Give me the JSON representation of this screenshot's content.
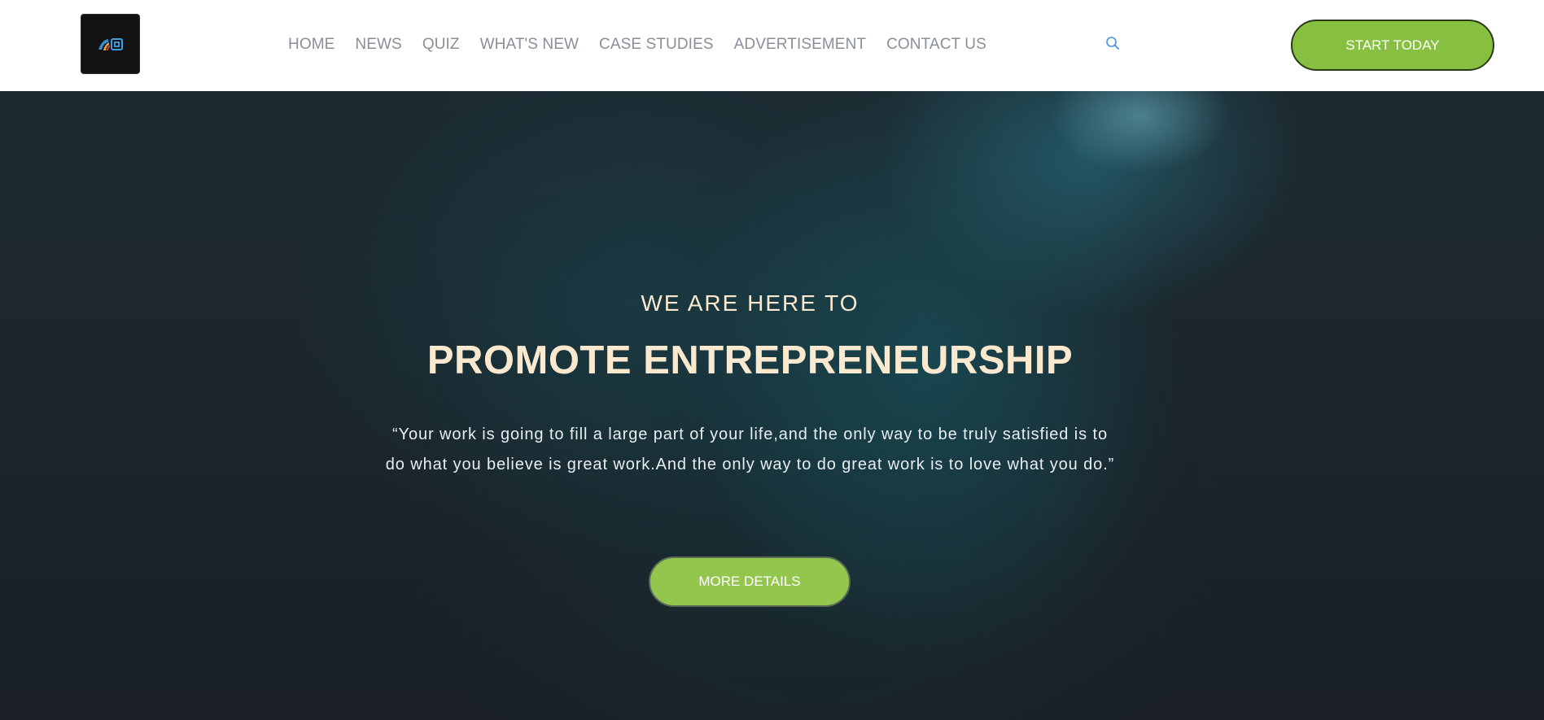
{
  "header": {
    "logo_icon": "brand-logo-icon",
    "nav": [
      {
        "label": "HOME"
      },
      {
        "label": "NEWS"
      },
      {
        "label": "QUIZ"
      },
      {
        "label": "WHAT'S NEW"
      },
      {
        "label": "CASE STUDIES"
      },
      {
        "label": "ADVERTISEMENT"
      },
      {
        "label": "CONTACT US"
      }
    ],
    "search_icon": "search-icon",
    "cta_label": "START TODAY"
  },
  "hero": {
    "eyebrow": "WE ARE HERE TO",
    "headline": "PROMOTE ENTREPRENEURSHIP",
    "quote": "“Your work is going to fill a large part of your life,and the only way to be truly satisfied is to do what you believe is great work.And the only way to do great work is to love what you do.”",
    "cta_label": "MORE DETAILS"
  },
  "colors": {
    "accent_green": "#87c041",
    "nav_text": "#8a8e99",
    "headline_text": "#fbe9cf",
    "hero_bg": "#1b2127",
    "search_icon": "#4a90d9"
  }
}
